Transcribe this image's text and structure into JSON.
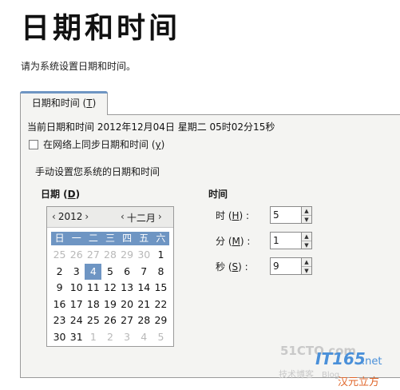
{
  "page": {
    "title": "日期和时间",
    "subtitle": "请为系统设置日期和时间。"
  },
  "tab": {
    "label": "日期和时间 (T)",
    "label_main": "日期和时间 (",
    "label_key": "T",
    "label_end": ")"
  },
  "current": {
    "text": "当前日期和时间  2012年12月04日  星期二  05时02分15秒"
  },
  "sync": {
    "label_main": "在网络上同步日期和时间 (",
    "label_key": "y",
    "label_end": ")",
    "checked": false
  },
  "manual": {
    "title": "手动设置您系统的日期和时间"
  },
  "date": {
    "label_main": "日期 (",
    "label_key": "D",
    "label_end": ")",
    "year": "2012",
    "month": "十二月",
    "weekdays": [
      "日",
      "一",
      "二",
      "三",
      "四",
      "五",
      "六"
    ],
    "days": [
      {
        "d": "25",
        "other": true
      },
      {
        "d": "26",
        "other": true
      },
      {
        "d": "27",
        "other": true
      },
      {
        "d": "28",
        "other": true
      },
      {
        "d": "29",
        "other": true
      },
      {
        "d": "30",
        "other": true
      },
      {
        "d": "1",
        "other": false
      },
      {
        "d": "2",
        "other": false
      },
      {
        "d": "3",
        "other": false
      },
      {
        "d": "4",
        "other": false,
        "selected": true
      },
      {
        "d": "5",
        "other": false
      },
      {
        "d": "6",
        "other": false
      },
      {
        "d": "7",
        "other": false
      },
      {
        "d": "8",
        "other": false
      },
      {
        "d": "9",
        "other": false
      },
      {
        "d": "10",
        "other": false
      },
      {
        "d": "11",
        "other": false
      },
      {
        "d": "12",
        "other": false
      },
      {
        "d": "13",
        "other": false
      },
      {
        "d": "14",
        "other": false
      },
      {
        "d": "15",
        "other": false
      },
      {
        "d": "16",
        "other": false
      },
      {
        "d": "17",
        "other": false
      },
      {
        "d": "18",
        "other": false
      },
      {
        "d": "19",
        "other": false
      },
      {
        "d": "20",
        "other": false
      },
      {
        "d": "21",
        "other": false
      },
      {
        "d": "22",
        "other": false
      },
      {
        "d": "23",
        "other": false
      },
      {
        "d": "24",
        "other": false
      },
      {
        "d": "25",
        "other": false
      },
      {
        "d": "26",
        "other": false
      },
      {
        "d": "27",
        "other": false
      },
      {
        "d": "28",
        "other": false
      },
      {
        "d": "29",
        "other": false
      },
      {
        "d": "30",
        "other": false
      },
      {
        "d": "31",
        "other": false
      },
      {
        "d": "1",
        "other": true
      },
      {
        "d": "2",
        "other": true
      },
      {
        "d": "3",
        "other": true
      },
      {
        "d": "4",
        "other": true
      },
      {
        "d": "5",
        "other": true
      }
    ]
  },
  "time": {
    "label": "时间",
    "hour": {
      "label_main": "时 (",
      "label_key": "H",
      "label_end": ") :",
      "value": "5"
    },
    "minute": {
      "label_main": "分 (",
      "label_key": "M",
      "label_end": ") :",
      "value": "1"
    },
    "second": {
      "label_main": "秒 (",
      "label_key": "S",
      "label_end": ") :",
      "value": "9"
    }
  },
  "watermark": {
    "site": "51CTO.com",
    "brand": "IT165",
    "tld": ".net",
    "blog": "技术博客",
    "blog_en": "Blog",
    "sub": "汉元立方"
  },
  "colors": {
    "accent": "#6e95c3",
    "panel_bg": "#f4f4f2"
  }
}
